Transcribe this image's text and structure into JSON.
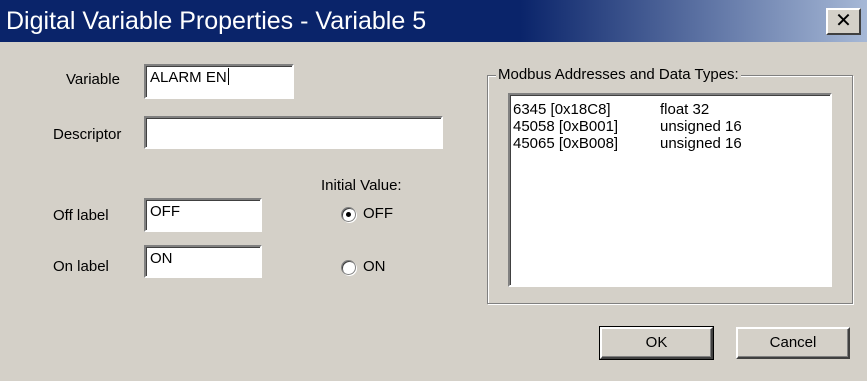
{
  "window": {
    "title": "Digital Variable Properties - Variable 5",
    "close_glyph": "✕"
  },
  "form": {
    "variable_label": "Variable",
    "variable_value": "ALARM EN",
    "descriptor_label": "Descriptor",
    "descriptor_value": "",
    "off_label_label": "Off label",
    "off_label_value": "OFF",
    "on_label_label": "On label",
    "on_label_value": "ON"
  },
  "initial_value": {
    "label": "Initial Value:",
    "options": [
      {
        "label": "OFF",
        "selected": true
      },
      {
        "label": "ON",
        "selected": false
      }
    ]
  },
  "modbus": {
    "title": "Modbus Addresses and Data Types:",
    "rows": [
      {
        "address": "6345 [0x18C8]",
        "type": "float 32"
      },
      {
        "address": "45058 [0xB001]",
        "type": "unsigned 16"
      },
      {
        "address": "45065 [0xB008]",
        "type": "unsigned 16"
      }
    ]
  },
  "buttons": {
    "ok": "OK",
    "cancel": "Cancel"
  },
  "colors": {
    "titlebar": "#0a246a",
    "face": "#d4d0c8"
  }
}
